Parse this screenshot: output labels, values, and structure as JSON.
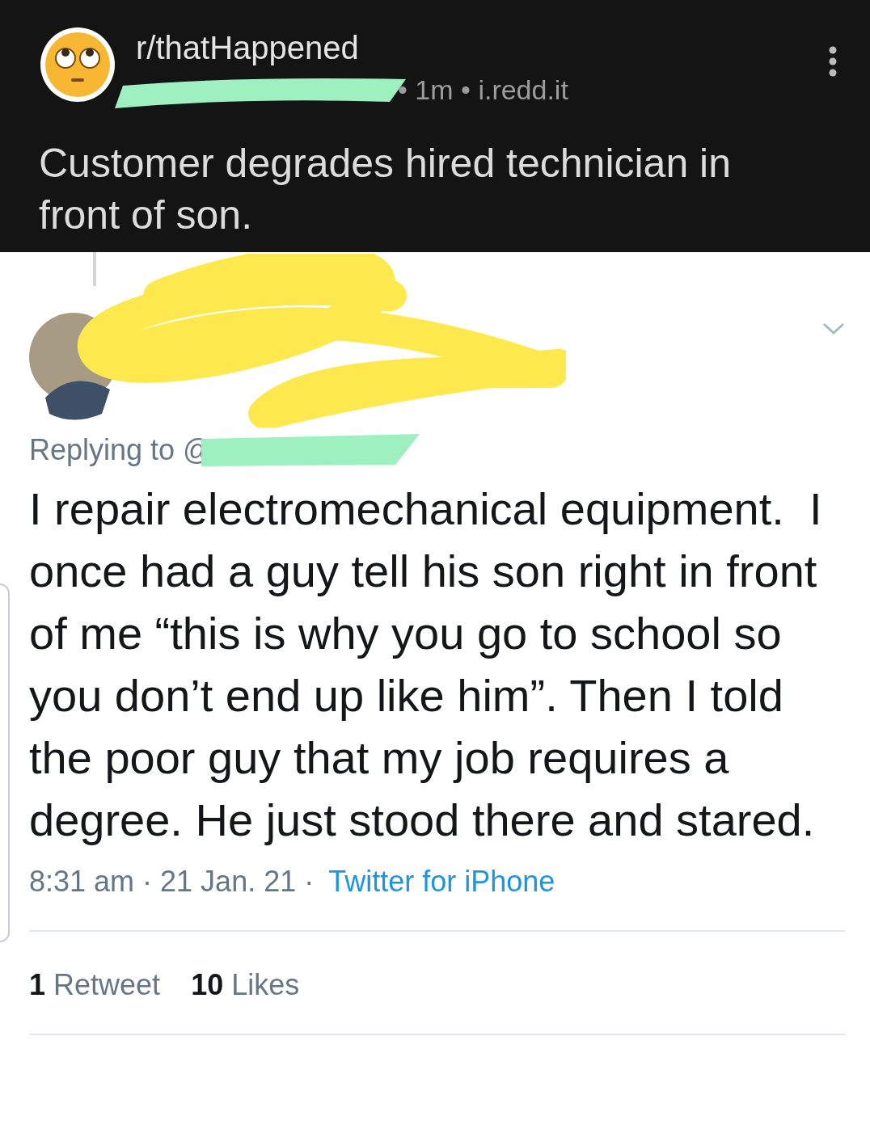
{
  "post": {
    "subreddit": "r/thatHappened",
    "meta": "• 1m • i.redd.it",
    "title": "Customer degrades hired technician in front of son."
  },
  "tweet": {
    "replying_to": "Replying to @",
    "text": "I repair electromechanical equipment.  I once had a guy tell his son right in front of me “this is why you go to school so you don’t end up like him”. Then I told the poor guy that my job requires a degree. He just stood there and stared.",
    "timestamp": "8:31 am · 21 Jan. 21 ·",
    "source": "Twitter for iPhone",
    "retweet_count": "1",
    "retweet_label": "Retweet",
    "like_count": "10",
    "like_label": "Likes"
  }
}
